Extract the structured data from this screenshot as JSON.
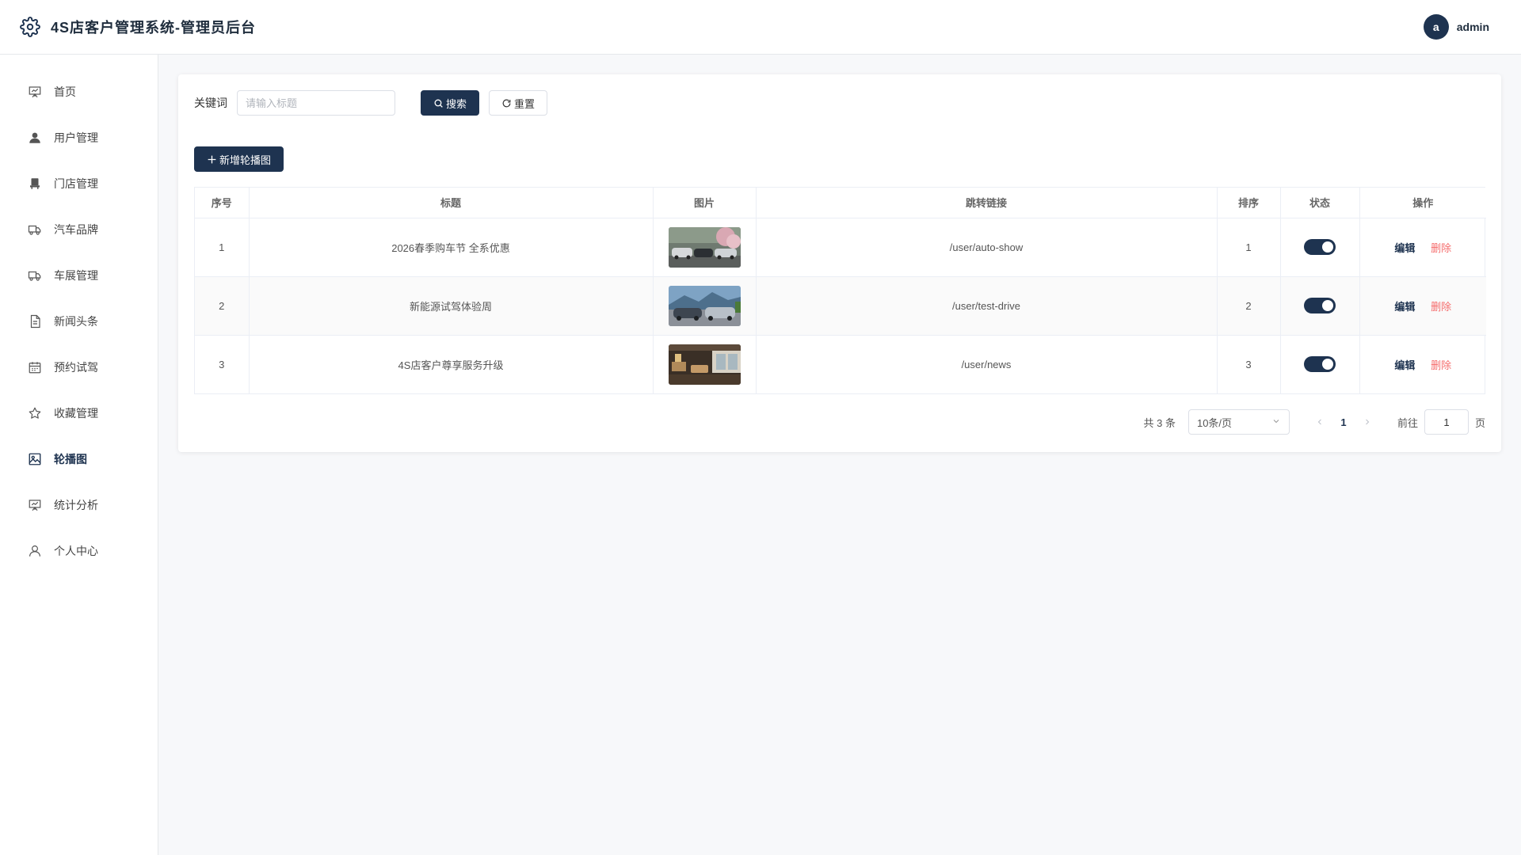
{
  "header": {
    "title": "4S店客户管理系统-管理员后台",
    "avatar_letter": "a",
    "username": "admin"
  },
  "sidebar": {
    "items": [
      {
        "label": "首页",
        "icon": "presentation-board-icon"
      },
      {
        "label": "用户管理",
        "icon": "user-filled-icon"
      },
      {
        "label": "门店管理",
        "icon": "store-icon"
      },
      {
        "label": "汽车品牌",
        "icon": "truck-icon"
      },
      {
        "label": "车展管理",
        "icon": "truck-icon"
      },
      {
        "label": "新闻头条",
        "icon": "document-icon"
      },
      {
        "label": "预约试驾",
        "icon": "calendar-icon"
      },
      {
        "label": "收藏管理",
        "icon": "star-icon"
      },
      {
        "label": "轮播图",
        "icon": "picture-icon",
        "active": true
      },
      {
        "label": "统计分析",
        "icon": "presentation-board-icon"
      },
      {
        "label": "个人中心",
        "icon": "user-outline-icon"
      }
    ]
  },
  "search": {
    "label": "关键词",
    "placeholder": "请输入标题",
    "value": "",
    "search_label": "搜索",
    "reset_label": "重置"
  },
  "toolbar": {
    "add_label": "新增轮播图"
  },
  "table": {
    "columns": [
      "序号",
      "标题",
      "图片",
      "跳转链接",
      "排序",
      "状态",
      "操作"
    ],
    "rows": [
      {
        "index": "1",
        "title": "2026春季购车节 全系优惠",
        "link": "/user/auto-show",
        "sort": "1",
        "status": true
      },
      {
        "index": "2",
        "title": "新能源试驾体验周",
        "link": "/user/test-drive",
        "sort": "2",
        "status": true
      },
      {
        "index": "3",
        "title": "4S店客户尊享服务升级",
        "link": "/user/news",
        "sort": "3",
        "status": true
      }
    ],
    "edit_label": "编辑",
    "delete_label": "删除"
  },
  "pagination": {
    "total_text": "共 3 条",
    "page_size": "10条/页",
    "current_page": "1",
    "goto_label": "前往",
    "goto_value": "1",
    "page_suffix": "页"
  },
  "colors": {
    "primary": "#1e3350",
    "danger": "#f56c6c",
    "background": "#f7f8fa"
  }
}
